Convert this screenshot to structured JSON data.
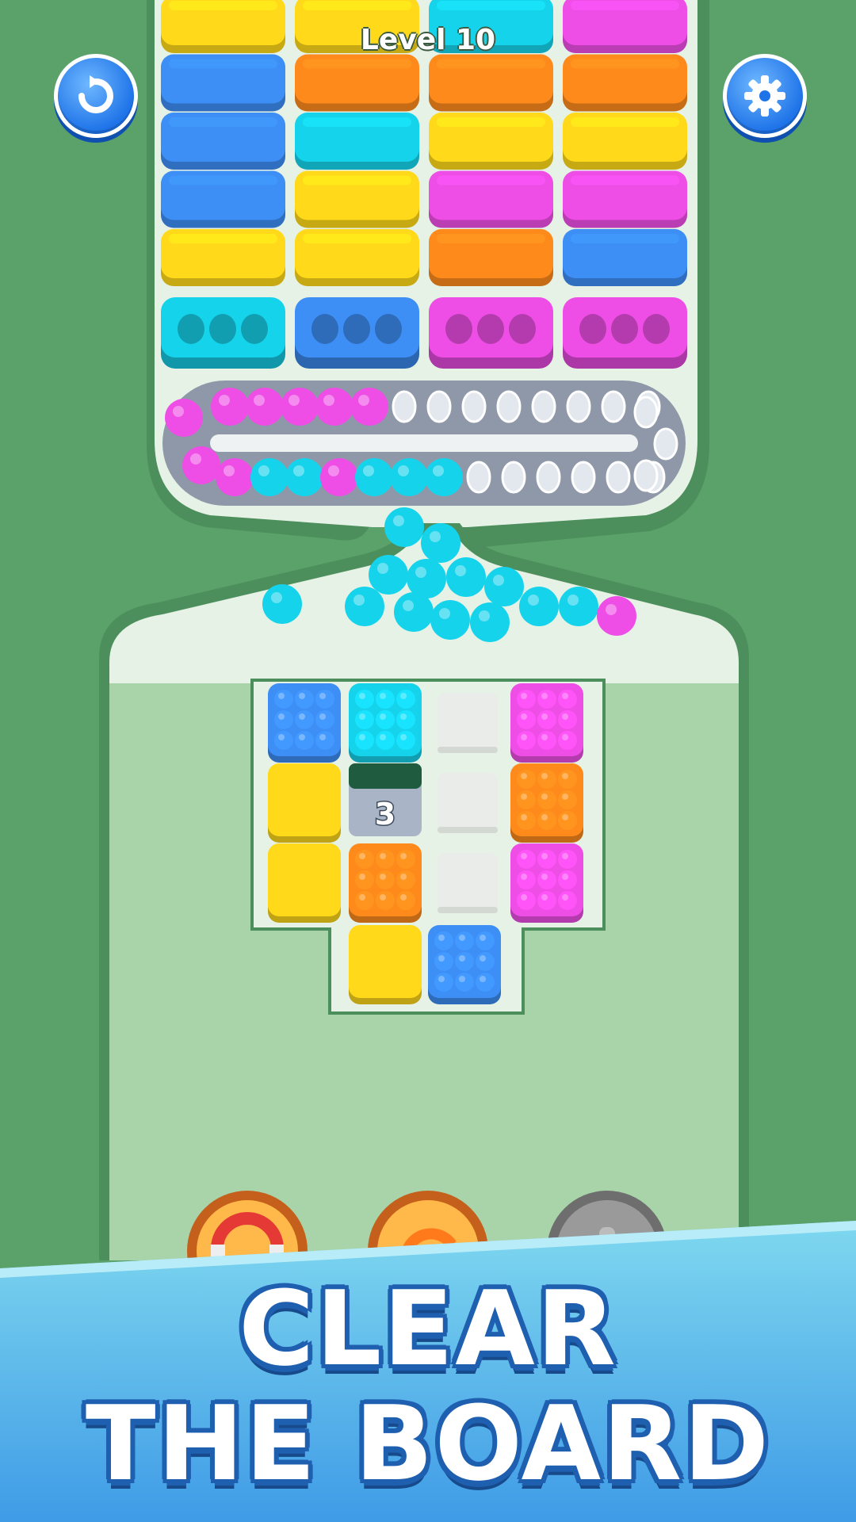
{
  "hud": {
    "level_text": "Level 10",
    "restart_icon": "restart-arrow-icon",
    "settings_icon": "gear-icon"
  },
  "colors": {
    "yellow": "#ffd91a",
    "blue": "#3d8ef5",
    "cyan": "#16d3ec",
    "magenta": "#ee4ee6",
    "orange": "#ff8a1c",
    "grey": "#e9ece9",
    "locked": "#a9b4c6",
    "bg": "#5aa16a",
    "tray": "#e6f2e6"
  },
  "bars": {
    "columns": [
      {
        "top_to_bottom": [
          "yellow",
          "blue",
          "blue",
          "blue",
          "yellow"
        ],
        "cap": "cyan"
      },
      {
        "top_to_bottom": [
          "yellow",
          "orange",
          "cyan",
          "yellow",
          "yellow"
        ],
        "cap": "blue"
      },
      {
        "top_to_bottom": [
          "cyan",
          "orange",
          "yellow",
          "magenta",
          "orange"
        ],
        "cap": "magenta"
      },
      {
        "top_to_bottom": [
          "magenta",
          "orange",
          "yellow",
          "magenta",
          "blue"
        ],
        "cap": "magenta"
      }
    ]
  },
  "conveyor": {
    "top_row": [
      "magenta",
      "magenta",
      "magenta",
      "magenta",
      "magenta",
      "empty",
      "empty",
      "empty",
      "empty",
      "empty",
      "empty",
      "empty",
      "empty"
    ],
    "bottom_row": [
      "magenta",
      "cyan",
      "cyan",
      "magenta",
      "cyan",
      "cyan",
      "cyan",
      "empty",
      "empty",
      "empty",
      "empty",
      "empty",
      "empty"
    ],
    "left_turn": [
      "magenta",
      "magenta"
    ],
    "right_turn": [
      "empty",
      "empty",
      "empty"
    ]
  },
  "falling_balls": [
    "cyan",
    "cyan",
    "cyan",
    "cyan",
    "cyan",
    "cyan",
    "cyan",
    "cyan",
    "cyan",
    "cyan",
    "cyan",
    "cyan",
    "cyan",
    "magenta"
  ],
  "grid": {
    "rows": [
      [
        "blue-pegs",
        "cyan-pegs",
        "empty",
        "magenta-pegs"
      ],
      [
        "yellow",
        "locked",
        "empty",
        "orange-pegs"
      ],
      [
        "yellow",
        "orange-pegs",
        "empty",
        "magenta-pegs"
      ],
      [
        "none",
        "yellow",
        "blue-pegs",
        "none"
      ]
    ],
    "locked_counter": "3"
  },
  "boosters": [
    {
      "name": "magnet",
      "icon": "magnet-icon"
    },
    {
      "name": "refresh",
      "icon": "refresh-icon"
    },
    {
      "name": "locked",
      "icon": "lock-icon"
    }
  ],
  "banner": {
    "line1": "CLEAR",
    "line2": "THE BOARD"
  }
}
